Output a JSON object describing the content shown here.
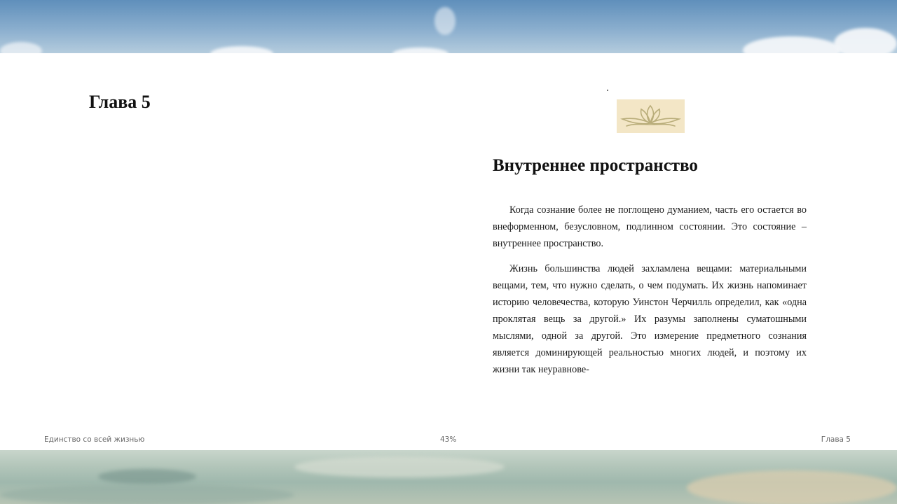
{
  "book": {
    "title": "Единство со всей жизнью",
    "progress": "43%",
    "current_chapter": "Глава 5"
  },
  "left_page": {
    "chapter_heading": "Глава 5"
  },
  "right_page": {
    "ornament_icon": "lotus-ornament-icon",
    "section_title": "Внутреннее пространство",
    "paragraphs": [
      "Когда сознание более не поглощено думанием, часть его остается во внеформенном, безусловном, подлинном состоянии. Это состояние – внутреннее пространство.",
      "Жизнь большинства людей захламлена вещами: материаль­ными вещами, тем, что нужно сделать, о чем подумать. Их жизнь напоминает историю человечества, которую Уинстон Чер­чилль определил, как «одна проклятая вещь за другой.» Их разумы заполнены суматошными мыслями, одной за другой. Это измерение предметного сознания является доминирующей реальностью многих людей, и поэтому их жизни так неуравнове-"
    ]
  },
  "colors": {
    "page_background": "#ffffff",
    "ornament_background": "#f3e6c6",
    "ornament_stroke": "#b9ad7a",
    "text": "#111111",
    "footer_text": "#666666"
  }
}
